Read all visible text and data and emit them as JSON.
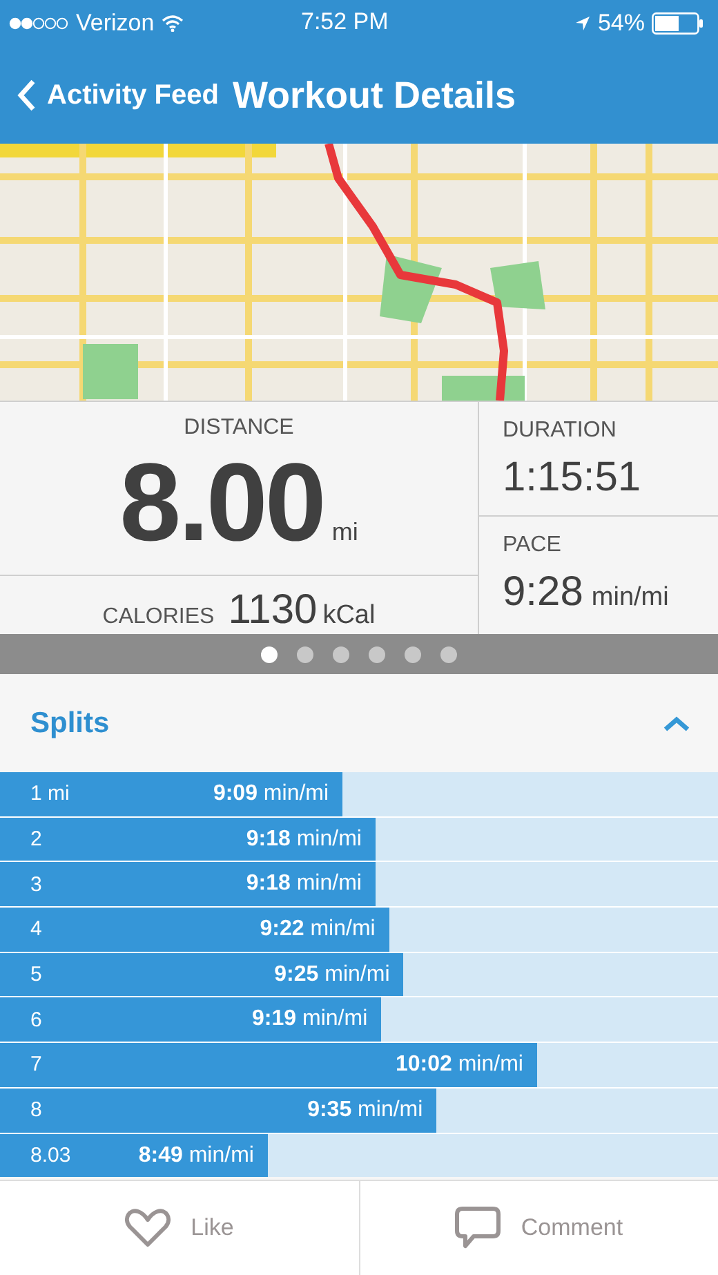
{
  "status_bar": {
    "carrier": "Verizon",
    "time": "7:52 PM",
    "battery": "54%"
  },
  "nav": {
    "back": "Activity Feed",
    "title": "Workout Details"
  },
  "stats": {
    "distance": {
      "label": "DISTANCE",
      "value": "8.00",
      "unit": "mi"
    },
    "calories": {
      "label": "CALORIES",
      "value": "1130",
      "unit": "kCal"
    },
    "duration": {
      "label": "DURATION",
      "value": "1:15:51"
    },
    "pace": {
      "label": "PACE",
      "value": "9:28",
      "unit": "min/mi"
    }
  },
  "pages": [
    {
      "selected": true
    },
    {
      "selected": false
    },
    {
      "selected": false
    },
    {
      "selected": false
    },
    {
      "selected": false
    },
    {
      "selected": false
    }
  ],
  "splits": {
    "title": "Splits",
    "expanded": true,
    "rows": [
      {
        "label": "1 mi",
        "pace": "**9:09** min/mi",
        "level": 0.477
      },
      {
        "label": "2",
        "pace": "**9:18** min/mi",
        "level": 0.523
      },
      {
        "label": "3",
        "pace": "**9:18** min/mi",
        "level": 0.523
      },
      {
        "label": "4",
        "pace": "**9:22** min/mi",
        "level": 0.542
      },
      {
        "label": "5",
        "pace": "**9:25** min/mi",
        "level": 0.562
      },
      {
        "label": "6",
        "pace": "**9:19** min/mi",
        "level": 0.531
      },
      {
        "label": "7",
        "pace": "**10:02** min/mi",
        "level": 0.748
      },
      {
        "label": "8",
        "pace": "**9:35** min/mi",
        "level": 0.608
      },
      {
        "label": "8.03",
        "pace": "**8:49** min/mi",
        "level": 0.373
      }
    ]
  },
  "actions": [
    {
      "kind": "like",
      "label": "Like"
    },
    {
      "kind": "comment",
      "label": "Comment"
    }
  ]
}
